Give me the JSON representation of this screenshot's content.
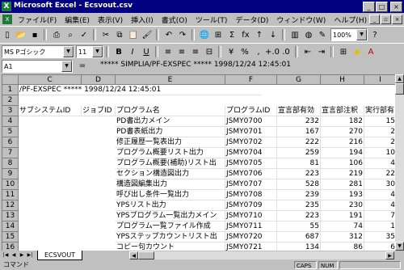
{
  "window": {
    "title": "Microsoft Excel - Ecsvout.csv",
    "app_icon_letter": "X"
  },
  "menu": [
    "ファイル(F)",
    "編集(E)",
    "表示(V)",
    "挿入(I)",
    "書式(O)",
    "ツール(T)",
    "データ(D)",
    "ウィンドウ(W)",
    "ヘルプ(H)"
  ],
  "toolbar": {
    "zoom": "100%",
    "font_name": "MS Pゴシック",
    "font_size": "11",
    "percent": "%",
    "comma": ",",
    "sigma": "Σ",
    "fx": "fx"
  },
  "formula_bar": {
    "cell_ref": "A1",
    "equals": "=",
    "content": "***** SIMPLIA/PF-EXSPEC ***** 1998/12/24 12:45:01"
  },
  "columns": [
    "C",
    "D",
    "E",
    "F",
    "G",
    "H",
    "I"
  ],
  "row_numbers": [
    "1",
    "2",
    "3",
    "4",
    "5",
    "6",
    "7",
    "8",
    "9",
    "10",
    "11",
    "12",
    "13",
    "14",
    "15",
    "16",
    "17"
  ],
  "row1_text": "/PF-EXSPEC ***** 1998/12/24 12:45:01",
  "headers": {
    "subsystem": "サブシステムID",
    "job": "ジョブID",
    "program": "プログラム名",
    "program_id": "プログラムID",
    "g": "宣言部有効",
    "h": "宣言部注釈",
    "i": "実行部有"
  },
  "rows": [
    {
      "name": "PD書出力メイン",
      "id": "JSMY0700",
      "g": "232",
      "h": "182",
      "i": "15"
    },
    {
      "name": "PD書表紙出力",
      "id": "JSMY0701",
      "g": "167",
      "h": "270",
      "i": "2"
    },
    {
      "name": "修正履歴一覧表出力",
      "id": "JSMY0702",
      "g": "222",
      "h": "216",
      "i": "2"
    },
    {
      "name": "プログラム概要リスト出力",
      "id": "JSMY0704",
      "g": "259",
      "h": "194",
      "i": "10"
    },
    {
      "name": "プログラム概要(補助)リスト出",
      "id": "JSMY0705",
      "g": "81",
      "h": "106",
      "i": "4"
    },
    {
      "name": "セクション構造図出力",
      "id": "JSMY0706",
      "g": "223",
      "h": "219",
      "i": "22"
    },
    {
      "name": "構造図編集出力",
      "id": "JSMY0707",
      "g": "528",
      "h": "281",
      "i": "30"
    },
    {
      "name": "呼び出し条件一覧出力",
      "id": "JSMY0708",
      "g": "239",
      "h": "193",
      "i": "4"
    },
    {
      "name": "YPSリスト出力",
      "id": "JSMY0709",
      "g": "235",
      "h": "230",
      "i": "4"
    },
    {
      "name": "YPSプログラム一覧出力メイン",
      "id": "JSMY0710",
      "g": "223",
      "h": "191",
      "i": "7"
    },
    {
      "name": "プログラム一覧ファイル作成",
      "id": "JSMY0711",
      "g": "55",
      "h": "74",
      "i": "1"
    },
    {
      "name": "YPSステップカウントリスト出",
      "id": "JSMY0720",
      "g": "687",
      "h": "312",
      "i": "35"
    },
    {
      "name": "コピー句カウント",
      "id": "JSMY0721",
      "g": "134",
      "h": "86",
      "i": "6"
    }
  ],
  "sheet_tab": "ECSVOUT",
  "status": {
    "text": "コマンド",
    "caps": "CAPS",
    "num": "NUM"
  }
}
